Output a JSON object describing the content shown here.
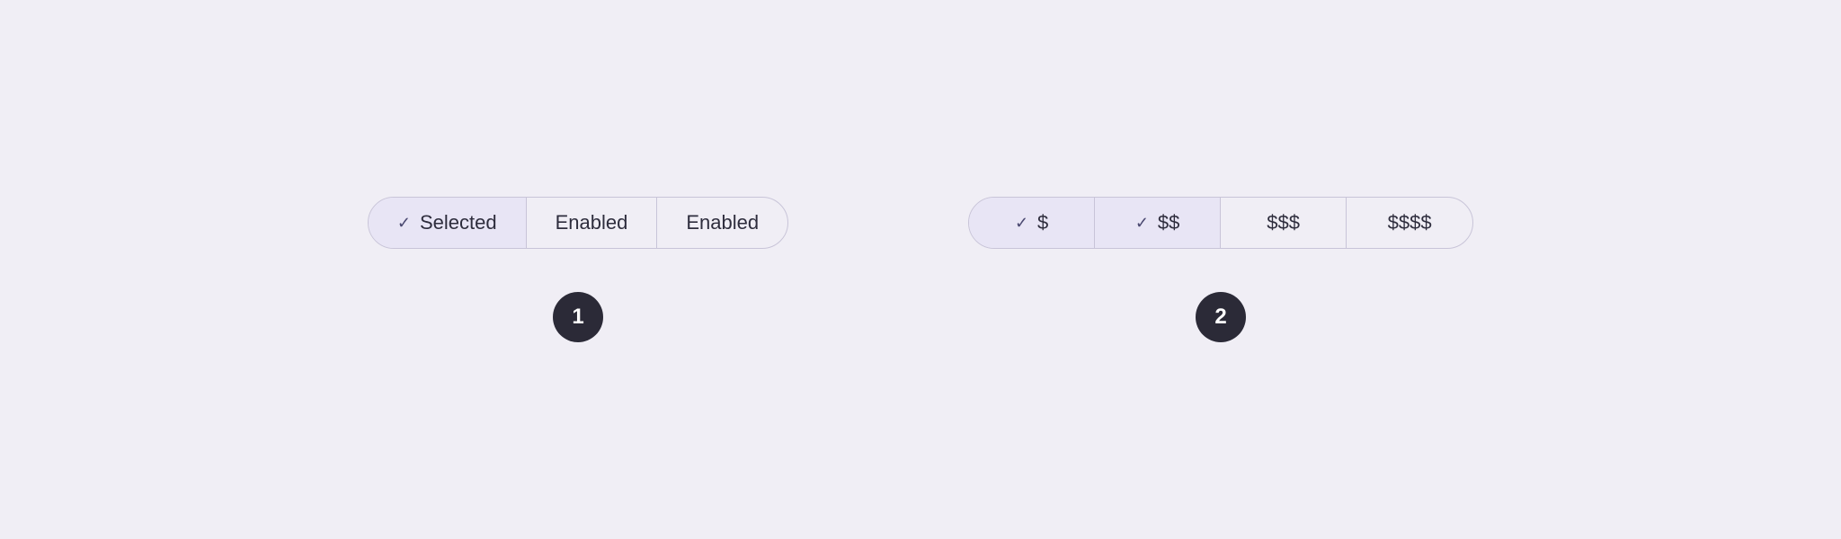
{
  "group1": {
    "segments": [
      {
        "id": "seg1-1",
        "label": "Selected",
        "selected": true,
        "showCheck": true
      },
      {
        "id": "seg1-2",
        "label": "Enabled",
        "selected": false,
        "showCheck": false
      },
      {
        "id": "seg1-3",
        "label": "Enabled",
        "selected": false,
        "showCheck": false
      }
    ],
    "badge": "1"
  },
  "group2": {
    "segments": [
      {
        "id": "seg2-1",
        "label": "$",
        "selected": true,
        "showCheck": true
      },
      {
        "id": "seg2-2",
        "label": "$$",
        "selected": true,
        "showCheck": true
      },
      {
        "id": "seg2-3",
        "label": "$$$",
        "selected": false,
        "showCheck": false
      },
      {
        "id": "seg2-4",
        "label": "$$$$",
        "selected": false,
        "showCheck": false
      }
    ],
    "badge": "2"
  },
  "icons": {
    "check": "✓"
  }
}
